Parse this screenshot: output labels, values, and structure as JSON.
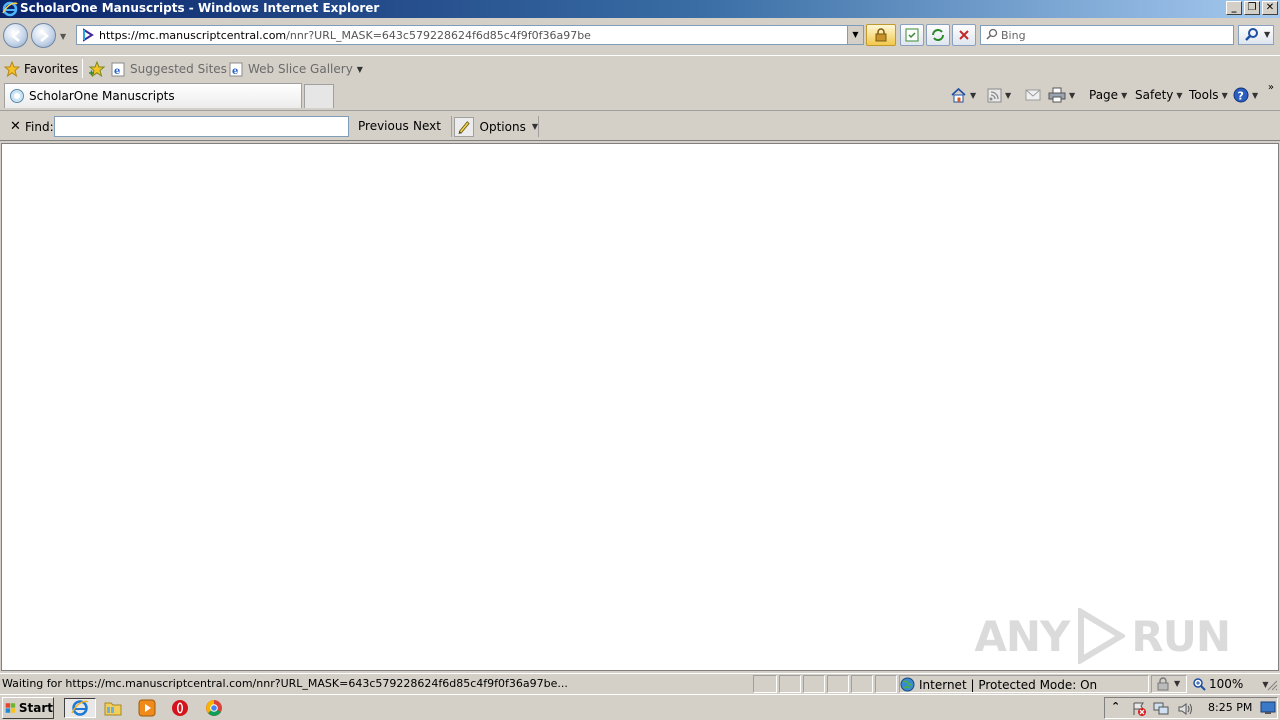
{
  "window": {
    "title": "ScholarOne Manuscripts - Windows Internet Explorer",
    "minimize_glyph": "_",
    "restore_glyph": "❐",
    "close_glyph": "✕"
  },
  "address_bar": {
    "url_host": "https://mc.manuscriptcentral.com",
    "url_path": "/nnr?URL_MASK=643c579228624f6d85c4f9f0f36a97be",
    "search_placeholder": "Bing"
  },
  "favorites_bar": {
    "favorites_label": "Favorites",
    "suggested_sites_label": "Suggested Sites",
    "web_slice_gallery_label": "Web Slice Gallery"
  },
  "tabs": [
    {
      "label": "ScholarOne Manuscripts"
    }
  ],
  "command_bar": {
    "page_label": "Page",
    "safety_label": "Safety",
    "tools_label": "Tools"
  },
  "find_bar": {
    "find_label": "Find:",
    "find_value": "",
    "previous_label": "Previous",
    "next_label": "Next",
    "options_label": "Options"
  },
  "status_bar": {
    "status_text": "Waiting for https://mc.manuscriptcentral.com/nnr?URL_MASK=643c579228624f6d85c4f9f0f36a97be...",
    "zone_text": "Internet | Protected Mode: On",
    "zoom_text": "100%"
  },
  "taskbar": {
    "start_label": "Start",
    "clock": "8:25 PM"
  },
  "watermark": {
    "text_left": "ANY",
    "text_right": "RUN"
  },
  "colors": {
    "title_bar": "#0a246a",
    "chrome": "#d4d0c8",
    "content_bg": "#ffffff"
  }
}
